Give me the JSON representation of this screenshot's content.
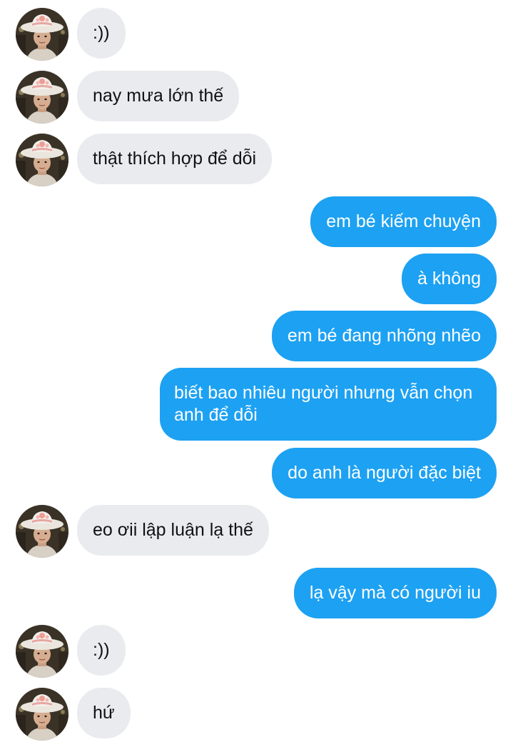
{
  "colors": {
    "incoming_bubble": "#e9ebef",
    "outgoing_bubble": "#1da1f2",
    "incoming_text": "#111111",
    "outgoing_text": "#ffffff"
  },
  "contact": {
    "avatar_icon": "contact-avatar-photo"
  },
  "messages": [
    {
      "sender": "contact",
      "text": ":))"
    },
    {
      "sender": "contact",
      "text": "nay mưa lớn thế"
    },
    {
      "sender": "contact",
      "text": "thật thích hợp để dỗi"
    },
    {
      "sender": "me",
      "text": "em bé kiếm chuyện"
    },
    {
      "sender": "me",
      "text": "à không"
    },
    {
      "sender": "me",
      "text": "em bé đang nhõng nhẽo"
    },
    {
      "sender": "me",
      "text": "biết bao nhiêu người nhưng vẫn chọn anh để dỗi"
    },
    {
      "sender": "me",
      "text": "do anh là người đặc biệt"
    },
    {
      "sender": "contact",
      "text": "eo ơii lập luận lạ thế"
    },
    {
      "sender": "me",
      "text": "lạ vậy mà có người iu"
    },
    {
      "sender": "contact",
      "text": ":))"
    },
    {
      "sender": "contact",
      "text": "hứ"
    }
  ]
}
